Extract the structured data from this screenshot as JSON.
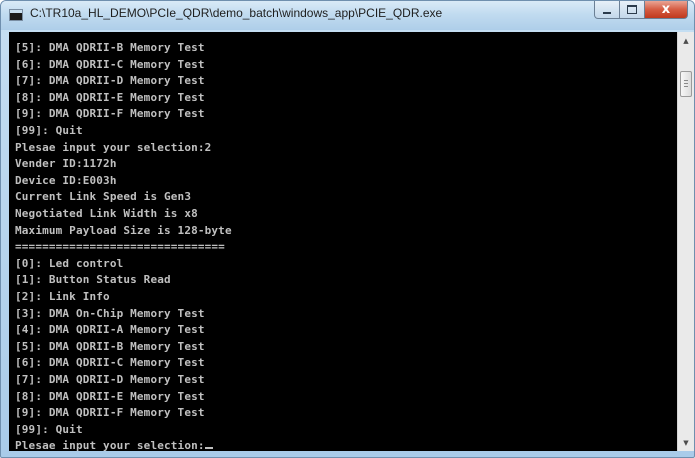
{
  "window": {
    "title": "C:\\TR10a_HL_DEMO\\PCIe_QDR\\demo_batch\\windows_app\\PCIE_QDR.exe",
    "close_glyph": "x"
  },
  "icons": {
    "app": "console-window-icon",
    "minimize": "minimize-icon",
    "maximize": "maximize-icon",
    "close": "close-icon",
    "scroll_up": "chevron-up-icon",
    "scroll_down": "chevron-down-icon"
  },
  "console": {
    "lines": [
      "[5]: DMA QDRII-B Memory Test",
      "[6]: DMA QDRII-C Memory Test",
      "[7]: DMA QDRII-D Memory Test",
      "[8]: DMA QDRII-E Memory Test",
      "[9]: DMA QDRII-F Memory Test",
      "[99]: Quit",
      "Plesae input your selection:2",
      "Vender ID:1172h",
      "Device ID:E003h",
      "Current Link Speed is Gen3",
      "Negotiated Link Width is x8",
      "Maximum Payload Size is 128-byte",
      "===============================",
      "[0]: Led control",
      "[1]: Button Status Read",
      "[2]: Link Info",
      "[3]: DMA On-Chip Memory Test",
      "[4]: DMA QDRII-A Memory Test",
      "[5]: DMA QDRII-B Memory Test",
      "[6]: DMA QDRII-C Memory Test",
      "[7]: DMA QDRII-D Memory Test",
      "[8]: DMA QDRII-E Memory Test",
      "[9]: DMA QDRII-F Memory Test",
      "[99]: Quit",
      "Plesae input your selection:"
    ]
  },
  "colors": {
    "console_bg": "#000000",
    "console_text": "#c0c0c0",
    "close_button": "#c7432a"
  }
}
